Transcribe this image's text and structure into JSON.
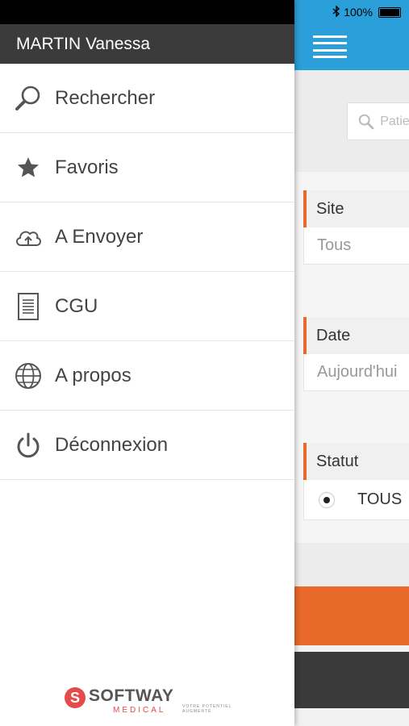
{
  "status_bar": {
    "battery": "100%"
  },
  "drawer": {
    "user_name": "MARTIN Vanessa",
    "menu": [
      {
        "label": "Rechercher",
        "icon": "search-icon"
      },
      {
        "label": "Favoris",
        "icon": "star-icon"
      },
      {
        "label": "A Envoyer",
        "icon": "cloud-upload-icon"
      },
      {
        "label": "CGU",
        "icon": "document-icon"
      },
      {
        "label": "A propos",
        "icon": "globe-icon"
      },
      {
        "label": "Déconnexion",
        "icon": "power-icon"
      }
    ],
    "brand": {
      "name": "SOFTWAY",
      "sub": "MEDICAL",
      "tagline_1": "VOTRE POTENTIEL",
      "tagline_2": "AUGMENTÉ"
    }
  },
  "main": {
    "search_placeholder": "Patient",
    "filters": {
      "site": {
        "label": "Site",
        "value": "Tous"
      },
      "date": {
        "label": "Date",
        "value": "Aujourd'hui"
      },
      "statut": {
        "label": "Statut",
        "option": "TOUS"
      }
    }
  },
  "colors": {
    "header_blue": "#2b9fd9",
    "accent_orange": "#e8692a",
    "drawer_header": "#3b3b3b",
    "brand_red": "#e54b4b"
  }
}
